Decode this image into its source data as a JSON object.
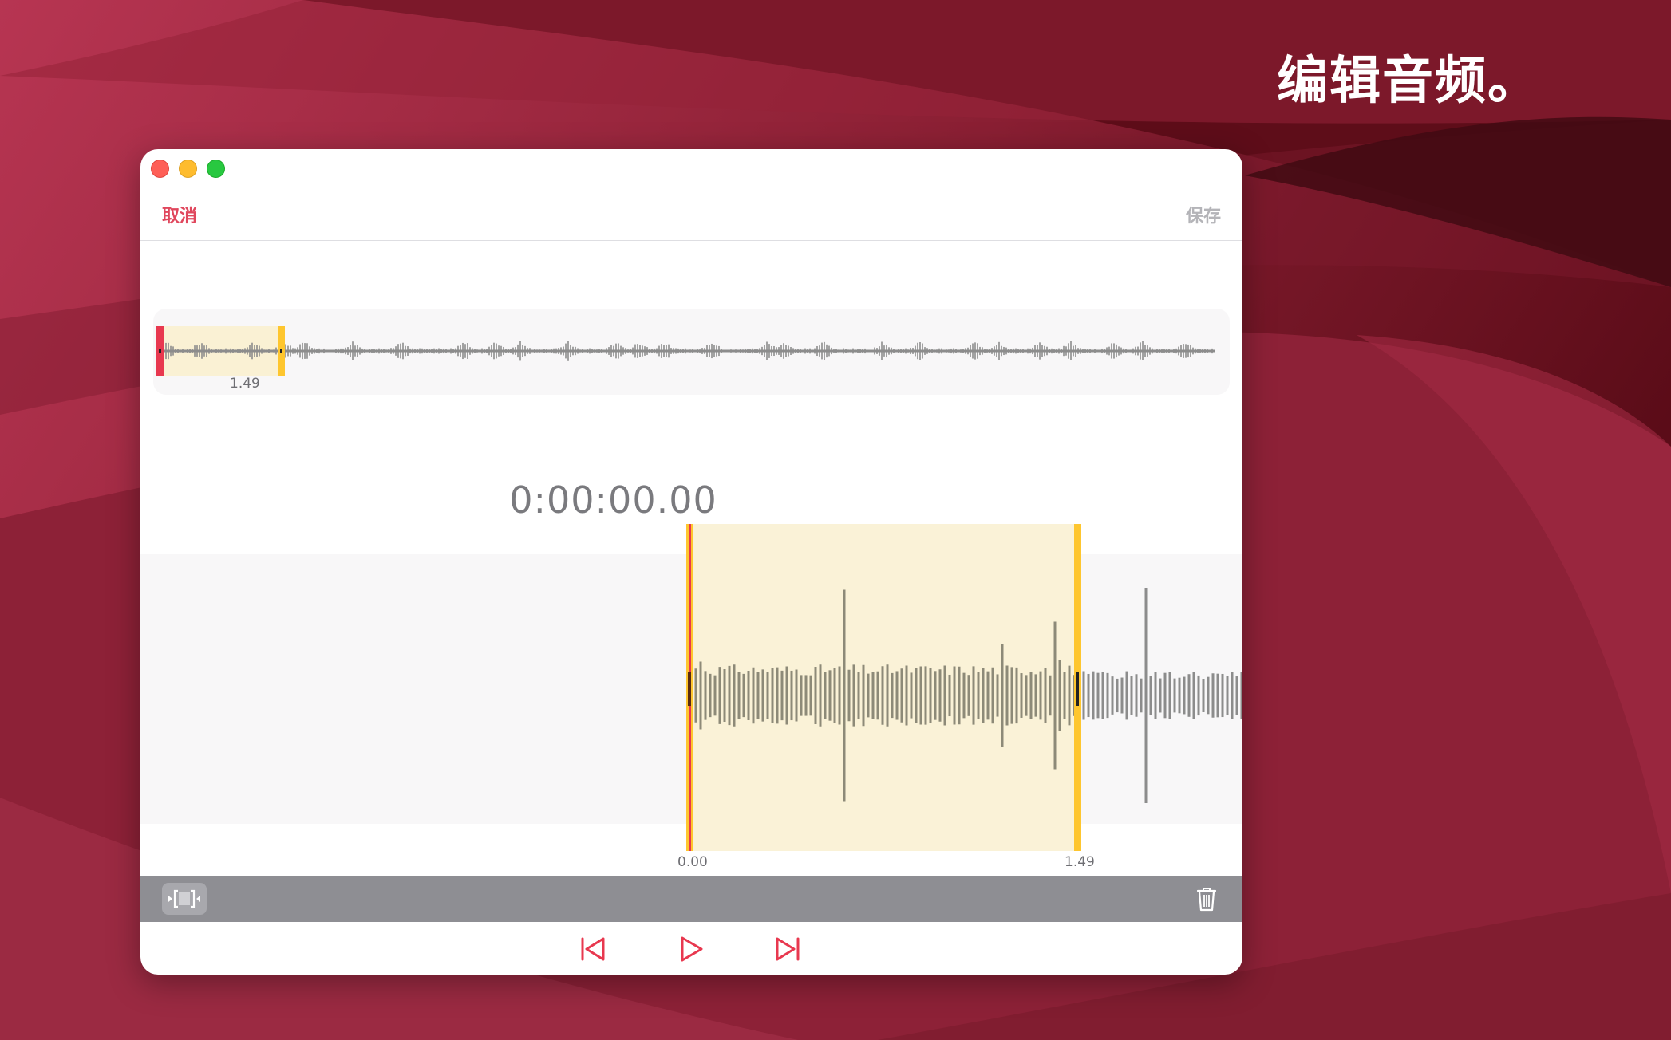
{
  "headline": "编辑音频。",
  "window": {
    "cancel_label": "取消",
    "save_label": "保存",
    "overview": {
      "selection_duration": "1.49"
    },
    "timecode": "0:00:00.00",
    "detail": {
      "start_label": "0.00",
      "end_label": "1.49"
    }
  },
  "colors": {
    "accent": "#e0475d",
    "selection_fill": "#faf1d4",
    "handle_yellow": "#fec62f",
    "playhead_red": "#e8384f",
    "waveform_gray": "#8c8c8c",
    "toolbar_gray": "#8e8e93"
  },
  "icons": {
    "trim": "trim-icon",
    "trash": "trash-icon",
    "skip_back": "skip-back-icon",
    "play": "play-icon",
    "skip_forward": "skip-forward-icon"
  }
}
